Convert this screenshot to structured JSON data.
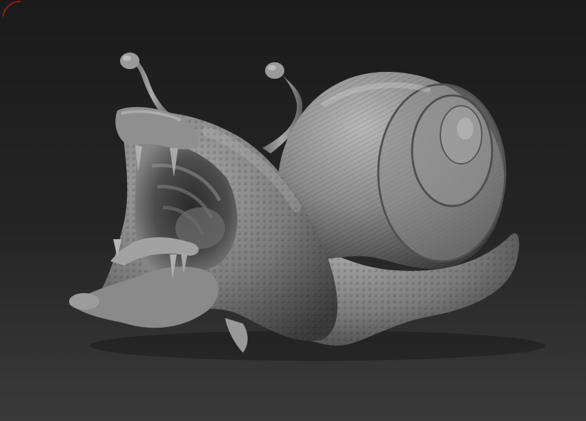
{
  "viewport": {
    "background_top": "#1b1b1b",
    "background_bottom": "#3a3a3a",
    "model": {
      "subject": "snail-sculpt",
      "material": "matcap-grey",
      "base_color": "#8e8e8e",
      "shadow_color": "#3e3e3e",
      "highlight_color": "#c8c8c8"
    },
    "corner_marker_color": "#a01818"
  }
}
